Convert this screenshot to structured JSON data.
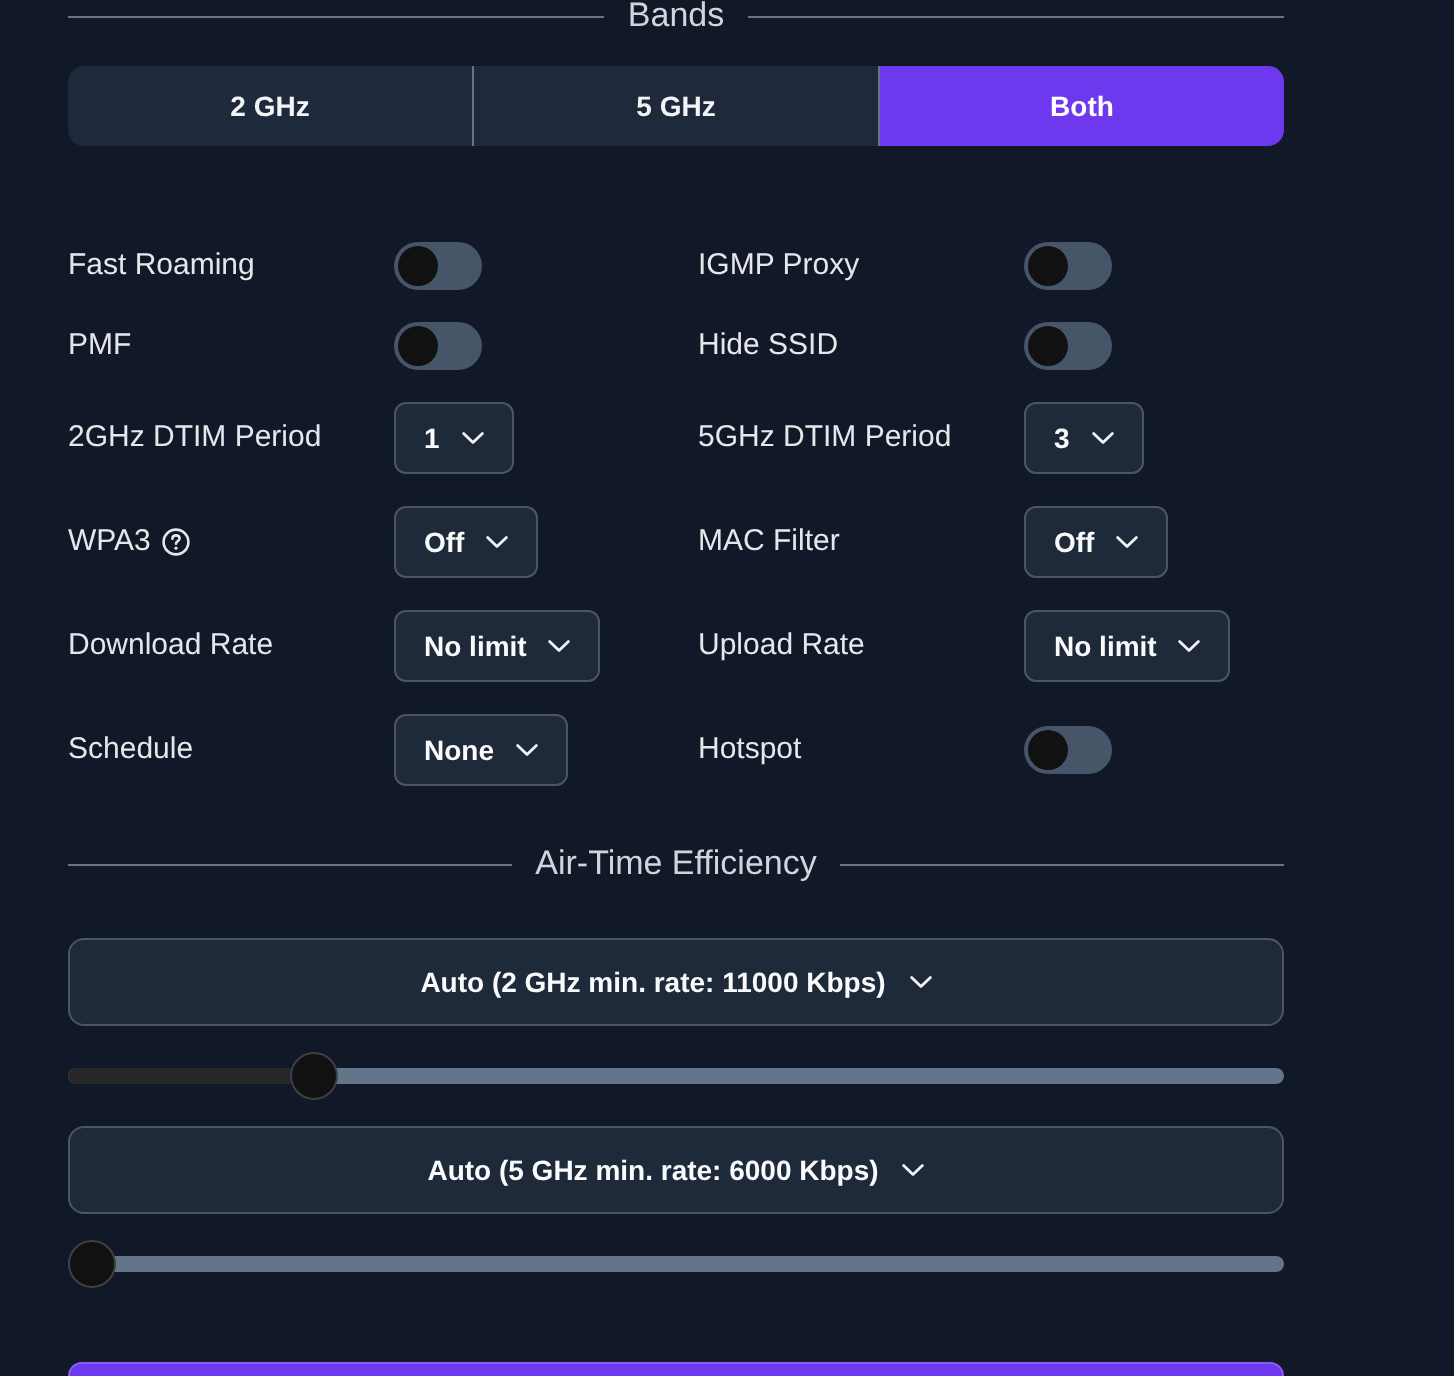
{
  "bands": {
    "title": "Bands",
    "options": [
      {
        "label": "2 GHz",
        "selected": false
      },
      {
        "label": "5 GHz",
        "selected": false
      },
      {
        "label": "Both",
        "selected": true
      }
    ]
  },
  "settings": [
    {
      "kind": "toggle",
      "label": "Fast Roaming",
      "on": false
    },
    {
      "kind": "toggle",
      "label": "IGMP Proxy",
      "on": false
    },
    {
      "kind": "toggle",
      "label": "PMF",
      "on": false
    },
    {
      "kind": "toggle",
      "label": "Hide SSID",
      "on": false
    },
    {
      "kind": "select",
      "label": "2GHz DTIM Period",
      "value": "1"
    },
    {
      "kind": "select",
      "label": "5GHz DTIM Period",
      "value": "3"
    },
    {
      "kind": "select",
      "label": "WPA3",
      "value": "Off",
      "help": true
    },
    {
      "kind": "select",
      "label": "MAC Filter",
      "value": "Off"
    },
    {
      "kind": "select",
      "label": "Download Rate",
      "value": "No limit"
    },
    {
      "kind": "select",
      "label": "Upload Rate",
      "value": "No limit"
    },
    {
      "kind": "select",
      "label": "Schedule",
      "value": "None"
    },
    {
      "kind": "toggle",
      "label": "Hotspot",
      "on": false
    }
  ],
  "air_time": {
    "title": "Air-Time Efficiency",
    "rates": [
      {
        "value": "Auto (2 GHz min. rate: 11000 Kbps)",
        "level": 0.19
      },
      {
        "value": "Auto (5 GHz min. rate: 6000 Kbps)",
        "level": 0
      }
    ]
  }
}
